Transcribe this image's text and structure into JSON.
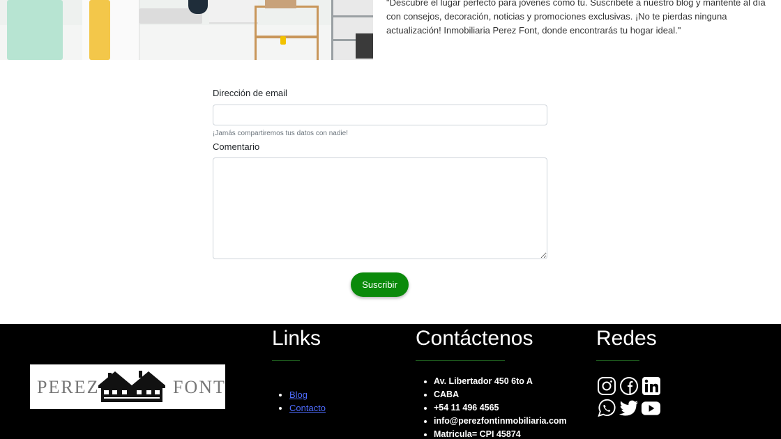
{
  "hero": {
    "text": "\"Descubre el lugar perfecto para jóvenes como tú. Suscríbete a nuestro blog y mantente al día con consejos, decoración, noticias y promociones exclusivas. ¡No te pierdas ninguna actualización! Inmobiliaria Perez Font, donde encontrarás tu hogar ideal.\""
  },
  "form": {
    "email_label": "Dirección de email",
    "email_value": "",
    "email_help": "¡Jamás compartiremos tus datos con nadie!",
    "comment_label": "Comentario",
    "comment_value": "",
    "submit_label": "Suscribir",
    "submit_color": "#0b8a0b"
  },
  "footer": {
    "logo": {
      "left": "PEREZ",
      "right": "FONT"
    },
    "links": {
      "title": "Links",
      "items": [
        {
          "label": "Blog"
        },
        {
          "label": "Contacto"
        }
      ]
    },
    "contact": {
      "title": "Contáctenos",
      "items": [
        "Av. Libertador 450 6to A",
        "CABA",
        "+54 11 496 4565",
        "info@perezfontinmobiliaria.com",
        "Matricula= CPI 45874"
      ]
    },
    "socials": {
      "title": "Redes",
      "icons": [
        "instagram-icon",
        "facebook-icon",
        "linkedin-icon",
        "whatsapp-icon",
        "twitter-icon",
        "youtube-icon"
      ]
    },
    "accent_color": "#1e5c1e"
  }
}
